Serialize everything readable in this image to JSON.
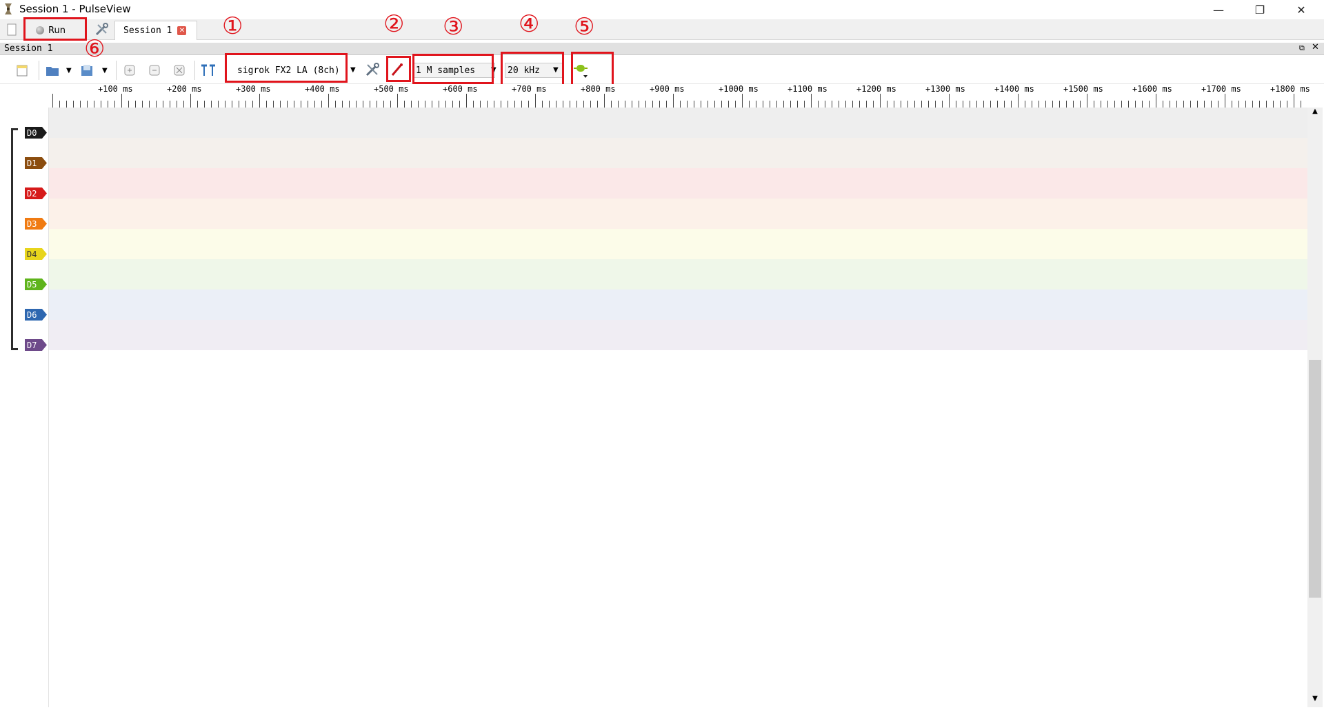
{
  "window": {
    "title": "Session 1 - PulseView",
    "min_glyph": "—",
    "max_glyph": "❐",
    "close_glyph": "✕"
  },
  "tabs": {
    "run_label": "Run",
    "session_tab_label": "Session 1",
    "close_glyph": "✕"
  },
  "dock": {
    "title": "Session 1",
    "float_glyph": "⧉",
    "close_glyph": "✕"
  },
  "toolbar": {
    "device": "sigrok FX2 LA (8ch)",
    "samples": "1 M samples",
    "samplerate": "20 kHz",
    "arrow": "▼"
  },
  "callouts": [
    "①",
    "②",
    "③",
    "④",
    "⑤",
    "⑥"
  ],
  "ruler": {
    "labels": [
      "+100 ms",
      "+200 ms",
      "+300 ms",
      "+400 ms",
      "+500 ms",
      "+600 ms",
      "+700 ms",
      "+800 ms",
      "+900 ms",
      "+1000 ms",
      "+1100 ms",
      "+1200 ms",
      "+1300 ms",
      "+1400 ms",
      "+1500 ms",
      "+1600 ms",
      "+1700 ms",
      "+1800 ms"
    ]
  },
  "channels": [
    {
      "name": "D0",
      "color": "#1a1a1a",
      "bg": "#eeeeee"
    },
    {
      "name": "D1",
      "color": "#8b4d0f",
      "bg": "#f4f0ec"
    },
    {
      "name": "D2",
      "color": "#d61a1a",
      "bg": "#fbe8e8"
    },
    {
      "name": "D3",
      "color": "#f07b12",
      "bg": "#fcf1e9"
    },
    {
      "name": "D4",
      "color": "#e8d51c",
      "bg": "#fcfce9"
    },
    {
      "name": "D5",
      "color": "#5fb41c",
      "bg": "#eff7e9"
    },
    {
      "name": "D6",
      "color": "#2e67b0",
      "bg": "#ebeff7"
    },
    {
      "name": "D7",
      "color": "#6e4a8a",
      "bg": "#f0edf3"
    }
  ],
  "scrollbar": {
    "up_glyph": "▲",
    "down_glyph": "▼"
  }
}
